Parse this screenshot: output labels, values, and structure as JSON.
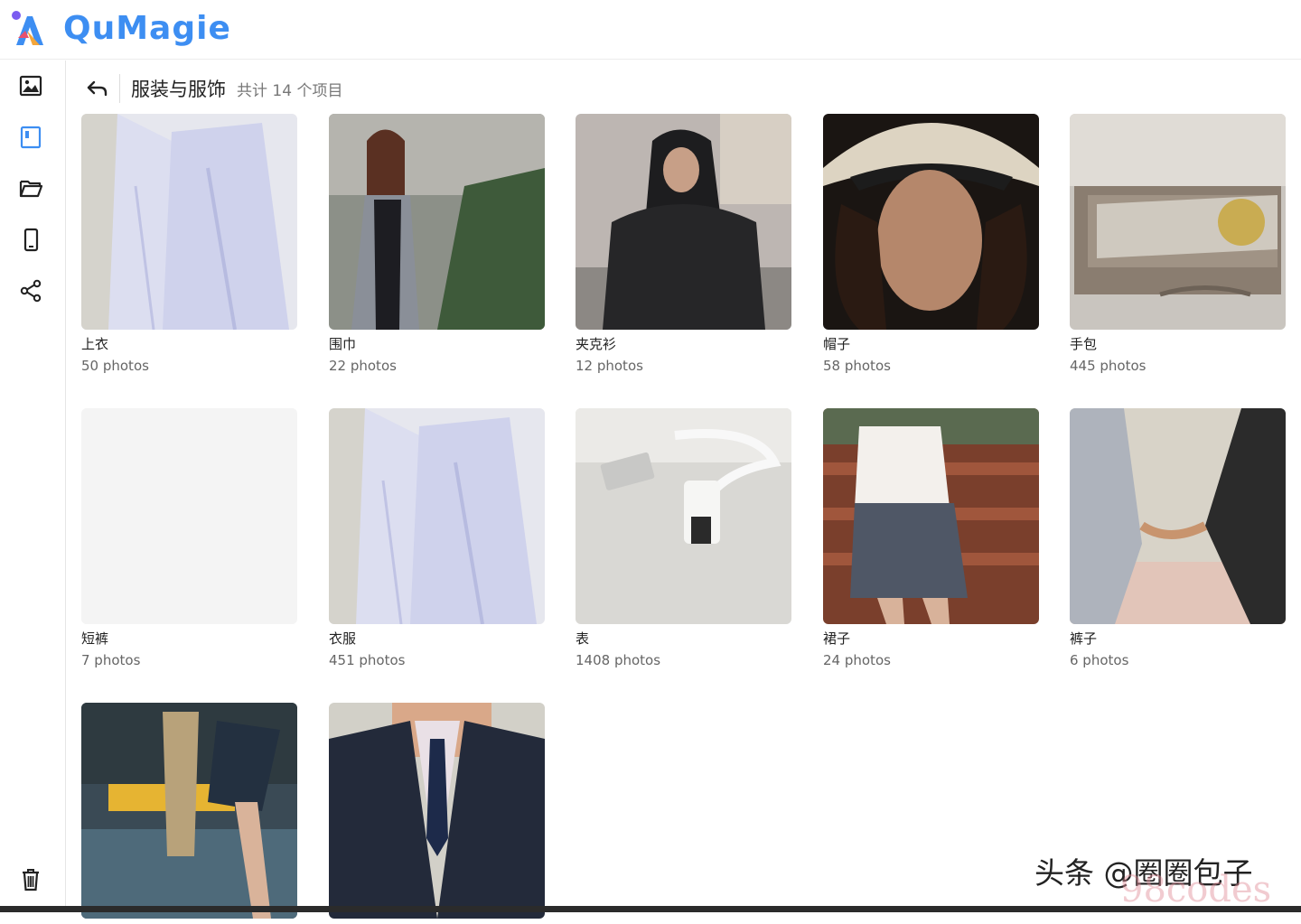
{
  "app": {
    "name": "QuMagie"
  },
  "sidebar": {
    "items": [
      {
        "name": "photos-icon"
      },
      {
        "name": "album-icon"
      },
      {
        "name": "folder-icon"
      },
      {
        "name": "mobile-icon"
      },
      {
        "name": "share-icon"
      }
    ],
    "bottom": {
      "name": "trash-icon"
    }
  },
  "header": {
    "title": "服装与服饰",
    "count": "共计 14 个项目"
  },
  "colors": {
    "brand": "#3d8ef2",
    "active_icon": "#3d8ef2"
  },
  "cards": [
    {
      "name": "上衣",
      "count": "50 photos"
    },
    {
      "name": "围巾",
      "count": "22 photos"
    },
    {
      "name": "夹克衫",
      "count": "12 photos"
    },
    {
      "name": "帽子",
      "count": "58 photos"
    },
    {
      "name": "手包",
      "count": "445 photos"
    },
    {
      "name": "短裤",
      "count": "7 photos"
    },
    {
      "name": "衣服",
      "count": "451 photos"
    },
    {
      "name": "表",
      "count": "1408 photos"
    },
    {
      "name": "裙子",
      "count": "24 photos"
    },
    {
      "name": "裤子",
      "count": "6 photos"
    },
    {
      "name": "",
      "count": ""
    },
    {
      "name": "",
      "count": ""
    }
  ],
  "watermark": {
    "text": "头条 @圈圈包子",
    "text2": "98codes"
  }
}
